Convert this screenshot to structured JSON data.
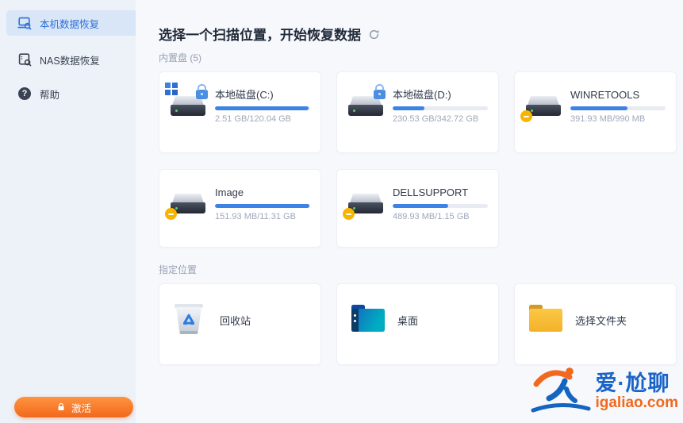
{
  "colors": {
    "accent_blue": "#2e6fd8",
    "bar_fill_blue": "#3d82e4",
    "activate_orange": "#f2681c",
    "warning_yellow": "#f7b500"
  },
  "sidebar": {
    "items": [
      {
        "label": "本机数据恢复",
        "icon": "pc-recovery-icon",
        "active": true
      },
      {
        "label": "NAS数据恢复",
        "icon": "nas-recovery-icon",
        "active": false
      },
      {
        "label": "帮助",
        "icon": "help-icon",
        "active": false
      }
    ],
    "activate": {
      "label": "激活",
      "icon": "lock-icon"
    }
  },
  "main": {
    "title": "选择一个扫描位置，开始恢复数据",
    "refresh_icon": "refresh-icon",
    "sections": [
      {
        "label": "内置盘 (5)",
        "cards": [
          {
            "name": "本地磁盘(C:)",
            "size": "2.51 GB/120.04 GB",
            "used_percent": 98,
            "icon": "hard-drive-icon",
            "badges": [
              "windows-logo",
              "lock"
            ]
          },
          {
            "name": "本地磁盘(D:)",
            "size": "230.53 GB/342.72 GB",
            "used_percent": 33,
            "icon": "hard-drive-icon",
            "badges": [
              "lock"
            ]
          },
          {
            "name": "WINRETOOLS",
            "size": "391.93 MB/990 MB",
            "used_percent": 60,
            "icon": "hard-drive-icon",
            "badges": [
              "warning-dot"
            ]
          },
          {
            "name": "Image",
            "size": "151.93 MB/11.31 GB",
            "used_percent": 99,
            "icon": "hard-drive-icon",
            "badges": [
              "warning-dot"
            ]
          },
          {
            "name": "DELLSUPPORT",
            "size": "489.93 MB/1.15 GB",
            "used_percent": 58,
            "icon": "hard-drive-icon",
            "badges": [
              "warning-dot"
            ]
          }
        ]
      },
      {
        "label": "指定位置",
        "cards": [
          {
            "name": "回收站",
            "icon": "recycle-bin-icon"
          },
          {
            "name": "桌面",
            "icon": "desktop-folder-icon"
          },
          {
            "name": "选择文件夹",
            "icon": "select-folder-icon"
          }
        ]
      }
    ]
  },
  "watermark": {
    "title": "爱·尬聊",
    "site": "igaliao.com"
  }
}
